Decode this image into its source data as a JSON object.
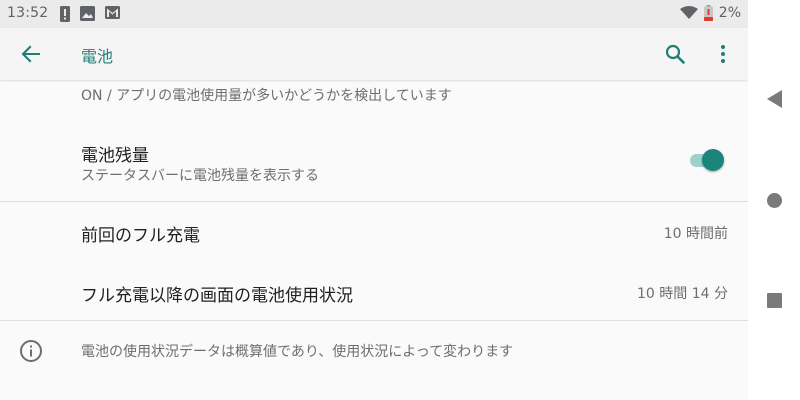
{
  "status_bar": {
    "time": "13:52",
    "battery_percent": "2%",
    "icons": [
      "alert-icon",
      "image-icon",
      "gmail-icon",
      "wifi-icon",
      "battery-low-icon"
    ]
  },
  "app_bar": {
    "title": "電池",
    "back_icon": "arrow-back-icon",
    "search_icon": "search-icon",
    "more_icon": "more-vert-icon"
  },
  "settings": {
    "partial_summary": "ON / アプリの電池使用量が多いかどうかを検出しています",
    "battery_percentage": {
      "title": "電池残量",
      "summary": "ステータスバーに電池残量を表示する",
      "enabled": true
    },
    "last_full_charge": {
      "title": "前回のフル充電",
      "value": "10 時間前"
    },
    "screen_usage": {
      "title": "フル充電以降の画面の電池使用状況",
      "value": "10 時間 14 分"
    },
    "footer": {
      "icon": "info-icon",
      "text": "電池の使用状況データは概算値であり、使用状況によって変わります"
    }
  },
  "colors": {
    "accent": "#1b857b",
    "toggle_track": "#9dd1cc",
    "title_text": "#1f7f77"
  },
  "system_nav": {
    "buttons": [
      "back-triangle-icon",
      "home-circle-icon",
      "recents-square-icon"
    ]
  }
}
